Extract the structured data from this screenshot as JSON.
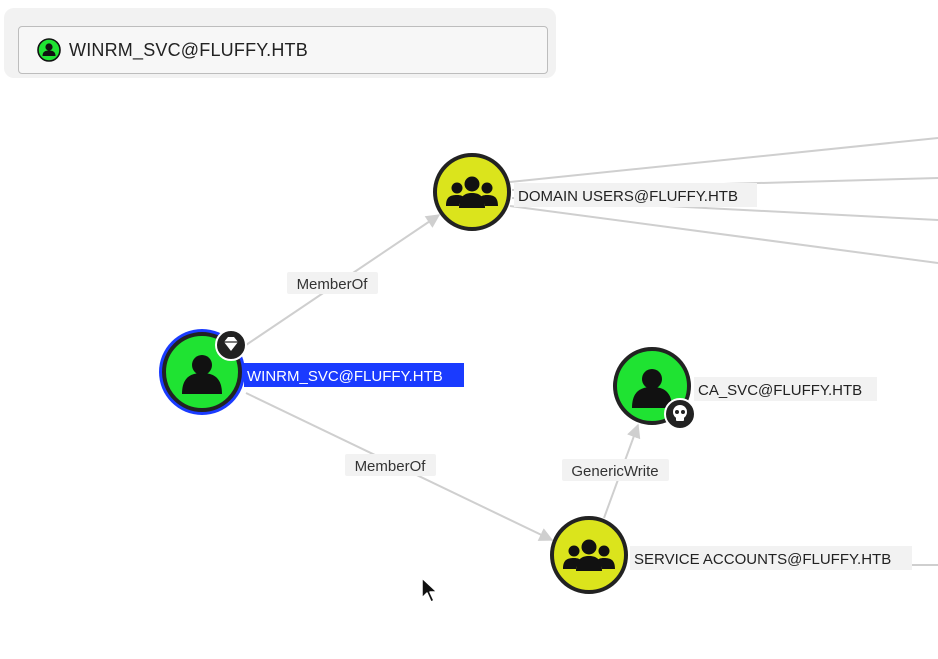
{
  "search": {
    "value": "WINRM_SVC@FLUFFY.HTB",
    "icon": "user-icon"
  },
  "nodes": {
    "winrm": {
      "label": "WINRM_SVC@FLUFFY.HTB",
      "type": "user",
      "badge": "gem-icon"
    },
    "domain_users": {
      "label": "DOMAIN USERS@FLUFFY.HTB",
      "type": "group"
    },
    "ca_svc": {
      "label": "CA_SVC@FLUFFY.HTB",
      "type": "user",
      "badge": "skull-icon"
    },
    "service_accounts": {
      "label": "SERVICE ACCOUNTS@FLUFFY.HTB",
      "type": "group"
    }
  },
  "edges": {
    "memberof_1": "MemberOf",
    "memberof_2": "MemberOf",
    "genericwrite": "GenericWrite"
  },
  "colors": {
    "user_fill": "#1fe332",
    "group_fill": "#dbe41c",
    "highlight": "#1a3bff",
    "edge": "#cfcfcf",
    "node_border": "#222222"
  }
}
